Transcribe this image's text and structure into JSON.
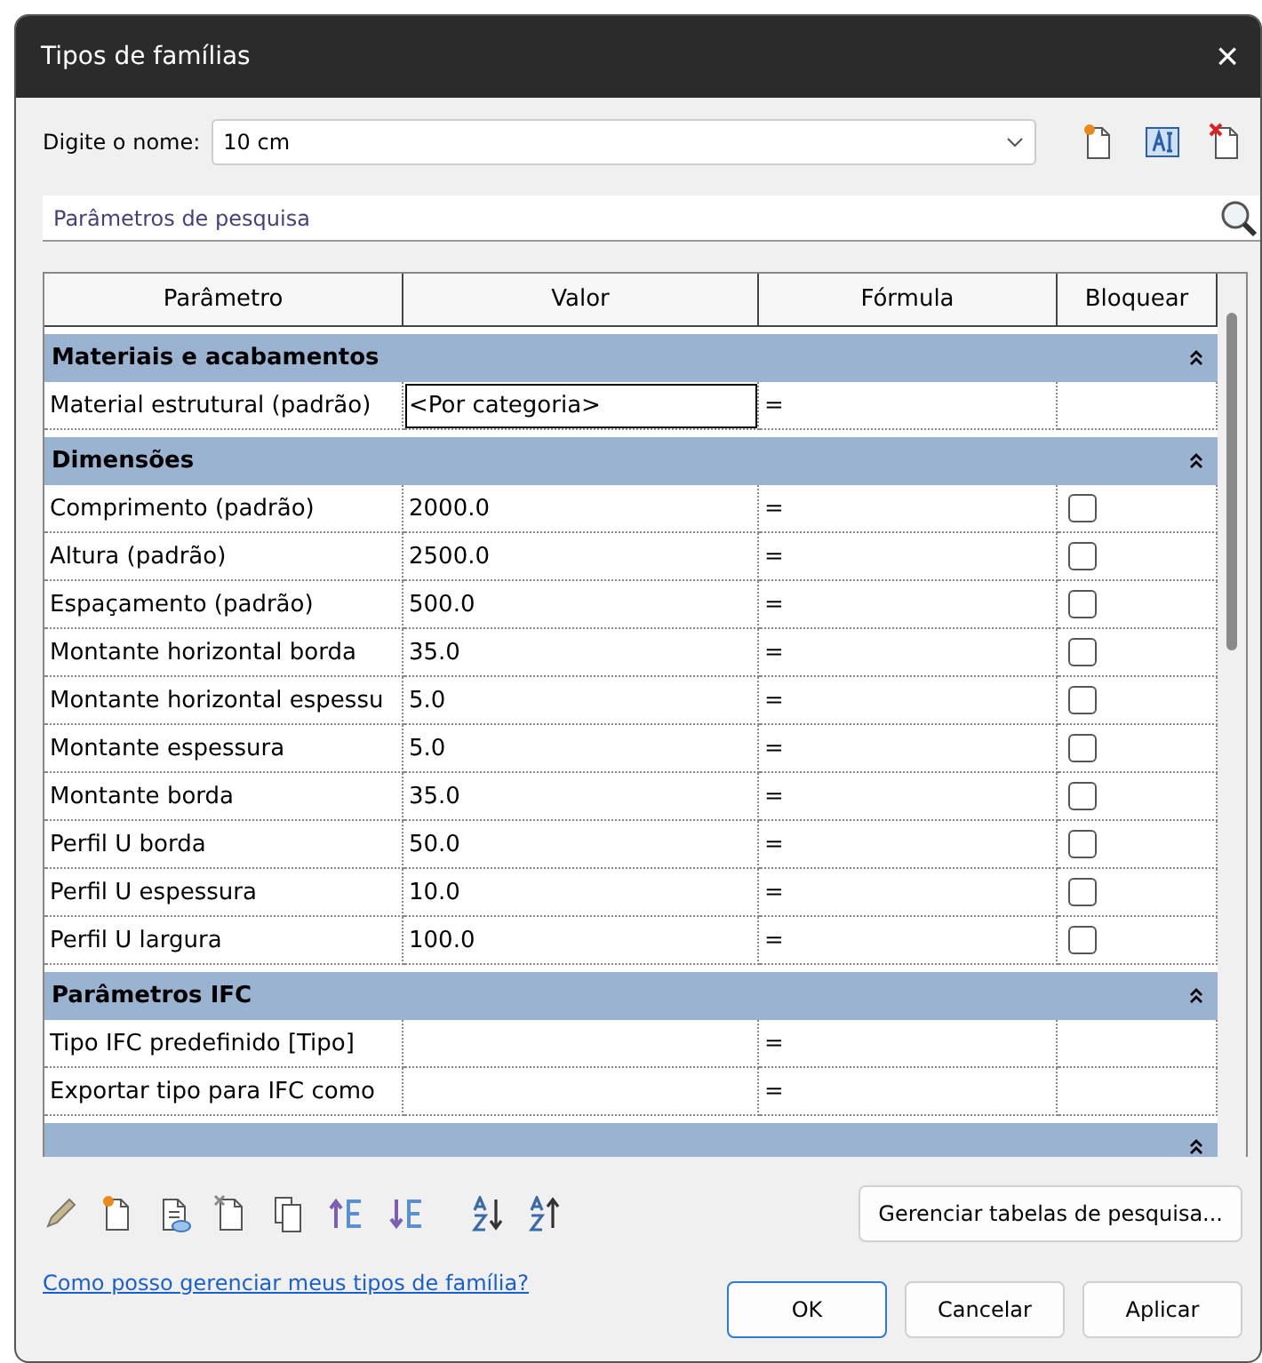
{
  "window": {
    "title": "Tipos de famílias",
    "close": "×"
  },
  "name_field": {
    "label": "Digite o nome:",
    "value": "10 cm"
  },
  "search": {
    "placeholder": "Parâmetros de pesquisa"
  },
  "table": {
    "columns": [
      "Parâmetro",
      "Valor",
      "Fórmula",
      "Bloquear"
    ],
    "groups": [
      {
        "title": "Materiais e acabamentos",
        "expanded": true,
        "rows": [
          {
            "kind": "plain",
            "name": "Material estrutural (padrão)",
            "value": "<Por categoria>",
            "formula": "=",
            "selected": true
          }
        ]
      },
      {
        "title": "Dimensões",
        "expanded": true,
        "rows": [
          {
            "kind": "lockable",
            "name": "Comprimento (padrão)",
            "value": "2000.0",
            "formula": "=",
            "selected": false,
            "locked": false
          },
          {
            "kind": "lockable",
            "name": "Altura (padrão)",
            "value": "2500.0",
            "formula": "=",
            "selected": false,
            "locked": false
          },
          {
            "kind": "lockable",
            "name": "Espaçamento (padrão)",
            "value": "500.0",
            "formula": "=",
            "selected": false,
            "locked": false
          },
          {
            "kind": "lockable",
            "name": "Montante horizontal borda",
            "value": "35.0",
            "formula": "=",
            "selected": false,
            "locked": false
          },
          {
            "kind": "lockable",
            "name": "Montante horizontal espessu",
            "value": "5.0",
            "formula": "=",
            "selected": false,
            "locked": false
          },
          {
            "kind": "lockable",
            "name": "Montante espessura",
            "value": "5.0",
            "formula": "=",
            "selected": false,
            "locked": false
          },
          {
            "kind": "lockable",
            "name": "Montante borda",
            "value": "35.0",
            "formula": "=",
            "selected": false,
            "locked": false
          },
          {
            "kind": "lockable",
            "name": "Perfil U borda",
            "value": "50.0",
            "formula": "=",
            "selected": false,
            "locked": false
          },
          {
            "kind": "lockable",
            "name": "Perfil U espessura",
            "value": "10.0",
            "formula": "=",
            "selected": false,
            "locked": false
          },
          {
            "kind": "lockable",
            "name": "Perfil U largura",
            "value": "100.0",
            "formula": "=",
            "selected": false,
            "locked": false
          }
        ]
      },
      {
        "title": "Parâmetros IFC",
        "expanded": true,
        "rows": [
          {
            "kind": "plain",
            "name": "Tipo IFC predefinido [Tipo]",
            "value": "",
            "formula": "=",
            "selected": false
          },
          {
            "kind": "plain",
            "name": "Exportar tipo para IFC como",
            "value": "",
            "formula": "=",
            "selected": false
          }
        ]
      },
      {
        "expanded": true
      }
    ]
  },
  "manage_button": "Gerenciar tabelas de pesquisa...",
  "help_link": "Como posso gerenciar meus tipos de família?",
  "buttons": [
    {
      "label": "OK",
      "default": true
    },
    {
      "label": "Cancelar",
      "default": false
    },
    {
      "label": "Aplicar",
      "default": false
    }
  ]
}
